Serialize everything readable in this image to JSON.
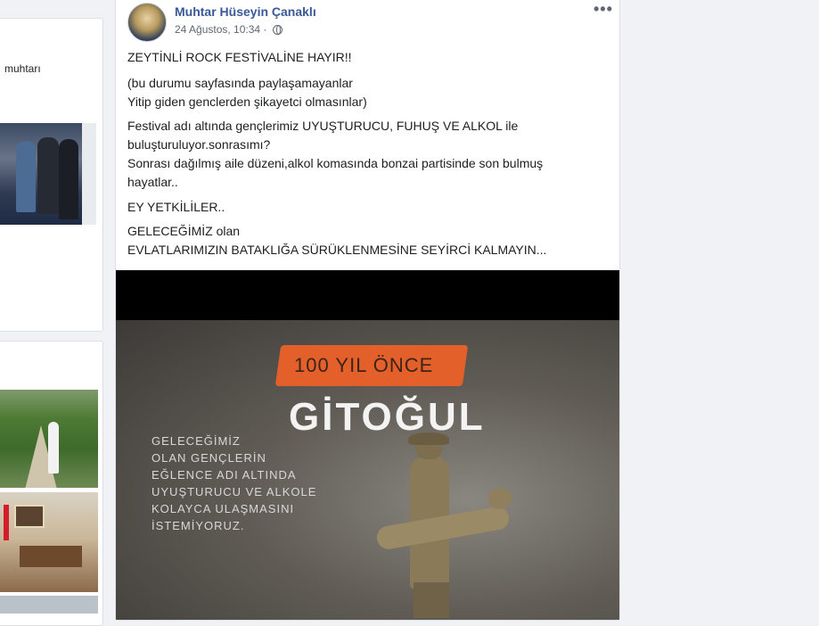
{
  "sidebar": {
    "card1_text": "muhtarı"
  },
  "post": {
    "author": "Muhtar Hüseyin Çanaklı",
    "timestamp": "24 Ağustos, 10:34 ·",
    "more_label": "•••",
    "lines": [
      "ZEYTİNLİ ROCK FESTİVALİNE HAYIR!!",
      "(bu durumu sayfasında paylaşamayanlar",
      "Yitip giden genclerden şikayetci olmasınlar)",
      "Festival adı altında gençlerimiz UYUŞTURUCU, FUHUŞ VE ALKOL ile",
      "buluşturuluyor.sonrasımı?",
      "Sonrası dağılmış aile düzeni,alkol komasında bonzai partisinde son bulmuş",
      "hayatlar..",
      "EY YETKİLİLER..",
      "GELECEĞİMİZ olan",
      "EVLATLARIMIZIN BATAKLIĞA SÜRÜKLENMESİNE SEYİRCİ KALMAYIN..."
    ]
  },
  "image": {
    "banner": "100 YIL ÖNCE",
    "title": "GİTOĞUL",
    "slogan": [
      "GELECEĞİMİZ",
      "OLAN GENÇLERİN",
      "EĞLENCE ADI ALTINDA",
      "UYUŞTURUCU VE ALKOLE",
      "KOLAYCA ULAŞMASINI",
      "İSTEMİYORUZ."
    ]
  },
  "colors": {
    "link": "#385898",
    "banner": "#e4602b",
    "background": "#f0f2f5"
  }
}
